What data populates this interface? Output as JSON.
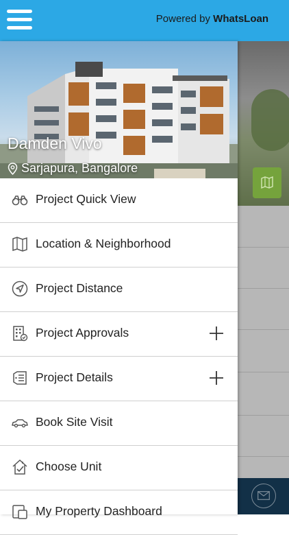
{
  "header": {
    "powered_prefix": "Powered by",
    "powered_brand": "WhatsLoan",
    "menu_icon": "hamburger-menu-icon",
    "bar_color": "#2ca8e5"
  },
  "project": {
    "name": "Damden Vivo",
    "location": "Sarjapura, Bangalore"
  },
  "menu": {
    "items": [
      {
        "label": "Project Quick View",
        "icon": "binoculars-icon",
        "expandable": false
      },
      {
        "label": "Location & Neighborhood",
        "icon": "map-icon",
        "expandable": false
      },
      {
        "label": "Project Distance",
        "icon": "navigation-icon",
        "expandable": false
      },
      {
        "label": "Project Approvals",
        "icon": "building-approval-icon",
        "expandable": true
      },
      {
        "label": "Project Details",
        "icon": "details-list-icon",
        "expandable": true
      },
      {
        "label": "Book Site Visit",
        "icon": "car-icon",
        "expandable": false
      },
      {
        "label": "Choose Unit",
        "icon": "home-check-icon",
        "expandable": false
      },
      {
        "label": "My Property Dashboard",
        "icon": "dashboard-icon",
        "expandable": false
      }
    ]
  },
  "background": {
    "map_button_color": "#75a33c",
    "footer_color": "#123047"
  }
}
